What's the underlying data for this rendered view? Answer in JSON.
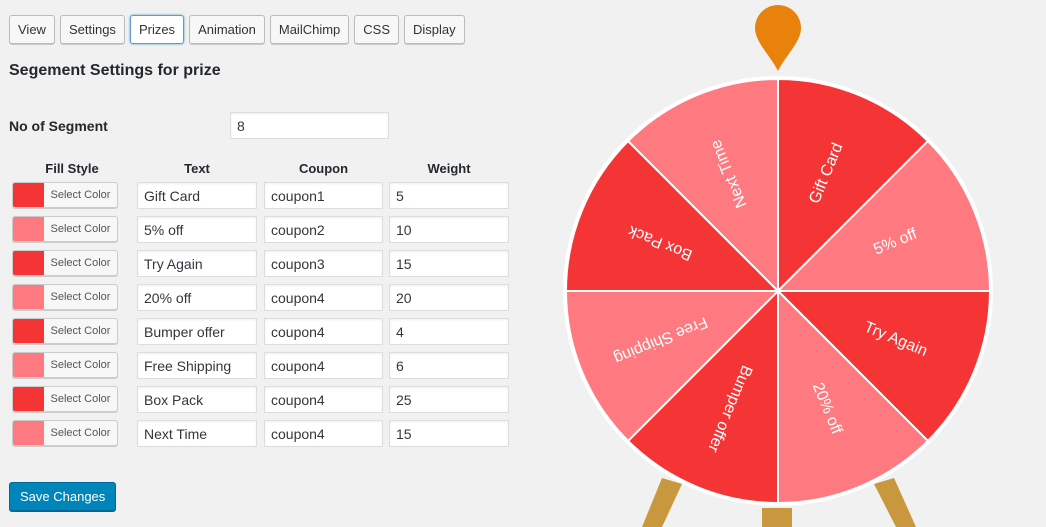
{
  "tabs": [
    {
      "label": "View"
    },
    {
      "label": "Settings"
    },
    {
      "label": "Prizes"
    },
    {
      "label": "Animation"
    },
    {
      "label": "MailChimp"
    },
    {
      "label": "CSS"
    },
    {
      "label": "Display"
    }
  ],
  "active_tab": "Prizes",
  "page_title": "Segement Settings for prize",
  "segment_count": {
    "label": "No of Segment",
    "value": "8"
  },
  "columns": {
    "fill": "Fill Style",
    "text": "Text",
    "coupon": "Coupon",
    "weight": "Weight"
  },
  "select_color_label": "Select Color",
  "colors": {
    "dark": "#f53535",
    "light": "#ff7a80"
  },
  "prizes": [
    {
      "fill": "dark",
      "text": "Gift Card",
      "coupon": "coupon1",
      "weight": "5"
    },
    {
      "fill": "light",
      "text": "5% off",
      "coupon": "coupon2",
      "weight": "10"
    },
    {
      "fill": "dark",
      "text": "Try Again",
      "coupon": "coupon3",
      "weight": "15"
    },
    {
      "fill": "light",
      "text": "20% off",
      "coupon": "coupon4",
      "weight": "20"
    },
    {
      "fill": "dark",
      "text": "Bumper offer",
      "coupon": "coupon4",
      "weight": "4"
    },
    {
      "fill": "light",
      "text": "Free Shipping",
      "coupon": "coupon4",
      "weight": "6"
    },
    {
      "fill": "dark",
      "text": "Box Pack",
      "coupon": "coupon4",
      "weight": "25"
    },
    {
      "fill": "light",
      "text": "Next Time",
      "coupon": "coupon4",
      "weight": "15"
    }
  ],
  "save_button": "Save Changes",
  "wheel": {
    "pointer_color": "#e8820c",
    "stand_color": "#c9973e"
  }
}
